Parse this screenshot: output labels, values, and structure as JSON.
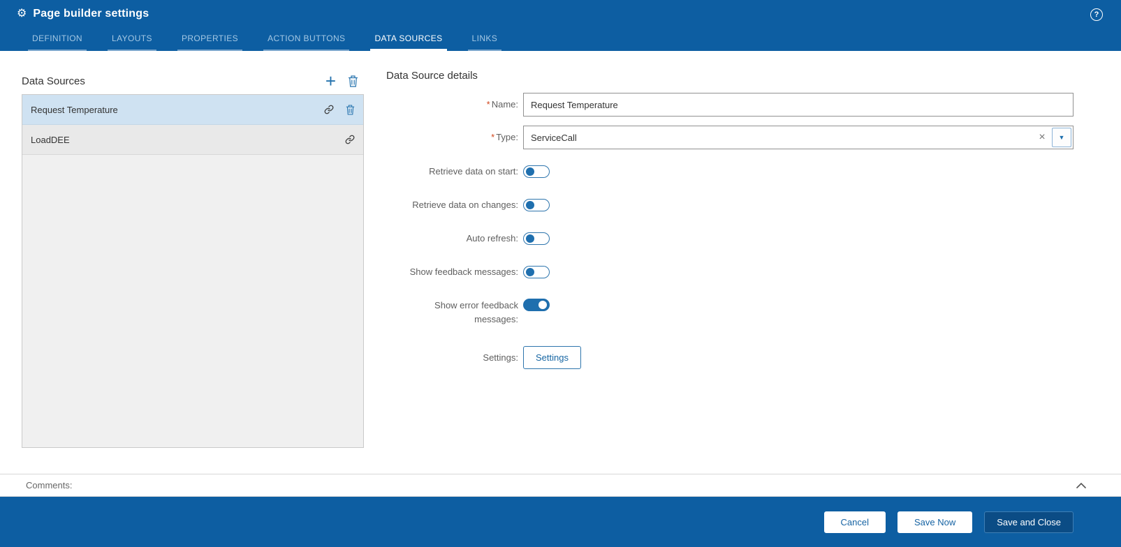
{
  "icons": {
    "gear": "⚙",
    "help": "?",
    "plus": "+",
    "clear": "×",
    "caret": "▼"
  },
  "header": {
    "title": "Page builder settings"
  },
  "tabs": [
    {
      "label": "DEFINITION",
      "active": false
    },
    {
      "label": "LAYOUTS",
      "active": false
    },
    {
      "label": "PROPERTIES",
      "active": false
    },
    {
      "label": "ACTION BUTTONS",
      "active": false
    },
    {
      "label": "DATA SOURCES",
      "active": true
    },
    {
      "label": "LINKS",
      "active": false
    }
  ],
  "data_sources_panel": {
    "title": "Data Sources",
    "items": [
      {
        "name": "Request Temperature",
        "selected": true
      },
      {
        "name": "LoadDEE",
        "selected": false
      }
    ]
  },
  "details": {
    "title": "Data Source details",
    "required_marker": "*",
    "name": {
      "label": "Name:",
      "value": "Request Temperature"
    },
    "type": {
      "label": "Type:",
      "value": "ServiceCall"
    },
    "toggles": [
      {
        "label": "Retrieve data on start:",
        "on": false
      },
      {
        "label": "Retrieve data on changes:",
        "on": false
      },
      {
        "label": "Auto refresh:",
        "on": false
      },
      {
        "label": "Show feedback messages:",
        "on": false
      },
      {
        "label": "Show error feedback messages:",
        "on": true
      }
    ],
    "settings": {
      "label": "Settings:",
      "button": "Settings"
    }
  },
  "comments": {
    "label": "Comments:"
  },
  "footer": {
    "cancel": "Cancel",
    "save_now": "Save Now",
    "save_and_close": "Save and Close"
  },
  "colors": {
    "primary": "#0d5ea2",
    "primary_dark": "#0b4c85",
    "selected_row": "#cfe2f2",
    "toggle_on": "#1f6fae"
  }
}
